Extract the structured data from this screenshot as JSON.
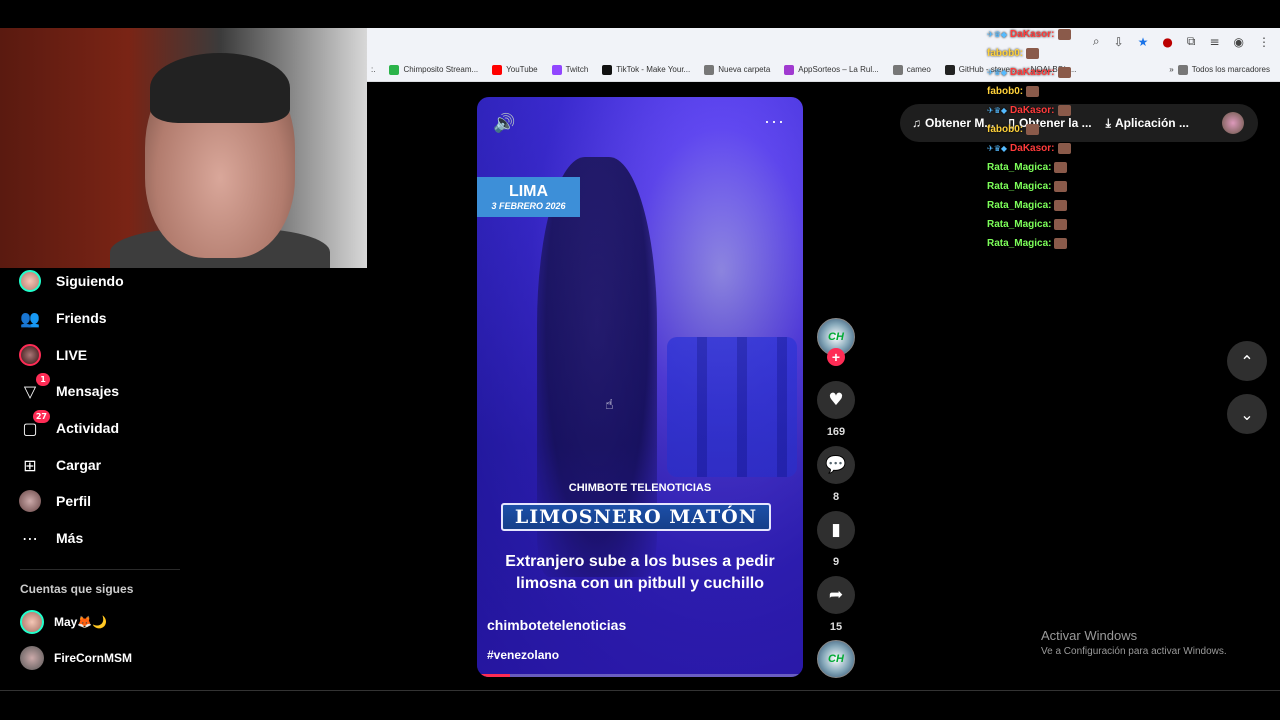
{
  "browser": {
    "bookmarks": [
      {
        "label": "Chimposito Stream...",
        "color": "#2bb34a"
      },
      {
        "label": "YouTube",
        "color": "#ff0000"
      },
      {
        "label": "Twitch",
        "color": "#9146ff"
      },
      {
        "label": "TikTok - Make Your...",
        "color": "#111111"
      },
      {
        "label": "Nueva carpeta",
        "color": "#777777"
      },
      {
        "label": "AppSorteos – La Rul...",
        "color": "#a03ad0"
      },
      {
        "label": "cameo",
        "color": "#777777"
      },
      {
        "label": "GitHub - steve...",
        "color": "#222222"
      }
    ],
    "bookmark_trailing": "NOALBS/n...",
    "all_bookmarks": "Todos los marcadores"
  },
  "sidebar": {
    "items": [
      {
        "label": "Siguiendo",
        "icon": "avatar"
      },
      {
        "label": "Friends",
        "icon": "friends-icon"
      },
      {
        "label": "LIVE",
        "icon": "live-avatar"
      },
      {
        "label": "Mensajes",
        "icon": "messages-icon",
        "badge": "1"
      },
      {
        "label": "Actividad",
        "icon": "activity-icon",
        "badge": "27"
      },
      {
        "label": "Cargar",
        "icon": "upload-icon"
      },
      {
        "label": "Perfil",
        "icon": "profile-avatar"
      },
      {
        "label": "Más",
        "icon": "more-icon"
      }
    ],
    "following_title": "Cuentas que sigues",
    "following": [
      {
        "name": "May🦊🌙"
      },
      {
        "name": "FireCornMSM"
      }
    ]
  },
  "video": {
    "location_city": "LIMA",
    "location_date": "3 FEBRERO 2026",
    "channel_line": "CHIMBOTE TELENOTICIAS",
    "headline": "LIMOSNERO MATÓN",
    "subhead": "Extranjero sube a los buses a pedir limosna con un pitbull y cuchillo",
    "author": "chimbotetelenoticias",
    "hashtag": "#venezolano",
    "progress": 0.1
  },
  "actions": {
    "likes": "169",
    "comments": "8",
    "saves": "9",
    "shares": "15",
    "avatar_text": "CH"
  },
  "toolbar": {
    "music": "Obtener M...",
    "app_get": "Obtener la ...",
    "app": "Aplicación ..."
  },
  "chat": [
    {
      "user": "DaKasor:",
      "color": "#ff3b3b",
      "badges": true
    },
    {
      "user": "fabob0:",
      "color": "#ffd23a",
      "badges": false
    },
    {
      "user": "DaKasor:",
      "color": "#ff3b3b",
      "badges": true
    },
    {
      "user": "fabob0:",
      "color": "#ffd23a",
      "badges": false
    },
    {
      "user": "DaKasor:",
      "color": "#ff3b3b",
      "badges": true
    },
    {
      "user": "fabob0:",
      "color": "#ffd23a",
      "badges": false
    },
    {
      "user": "DaKasor:",
      "color": "#ff3b3b",
      "badges": true
    },
    {
      "user": "Rata_Magica:",
      "color": "#7dff5a",
      "badges": false
    },
    {
      "user": "Rata_Magica:",
      "color": "#7dff5a",
      "badges": false
    },
    {
      "user": "Rata_Magica:",
      "color": "#7dff5a",
      "badges": false
    },
    {
      "user": "Rata_Magica:",
      "color": "#7dff5a",
      "badges": false
    },
    {
      "user": "Rata_Magica:",
      "color": "#7dff5a",
      "badges": false
    }
  ],
  "windows_activation": {
    "title": "Activar Windows",
    "subtitle": "Ve a Configuración para activar Windows."
  },
  "colors": {
    "accent": "#fe2c55",
    "background": "#000000"
  }
}
